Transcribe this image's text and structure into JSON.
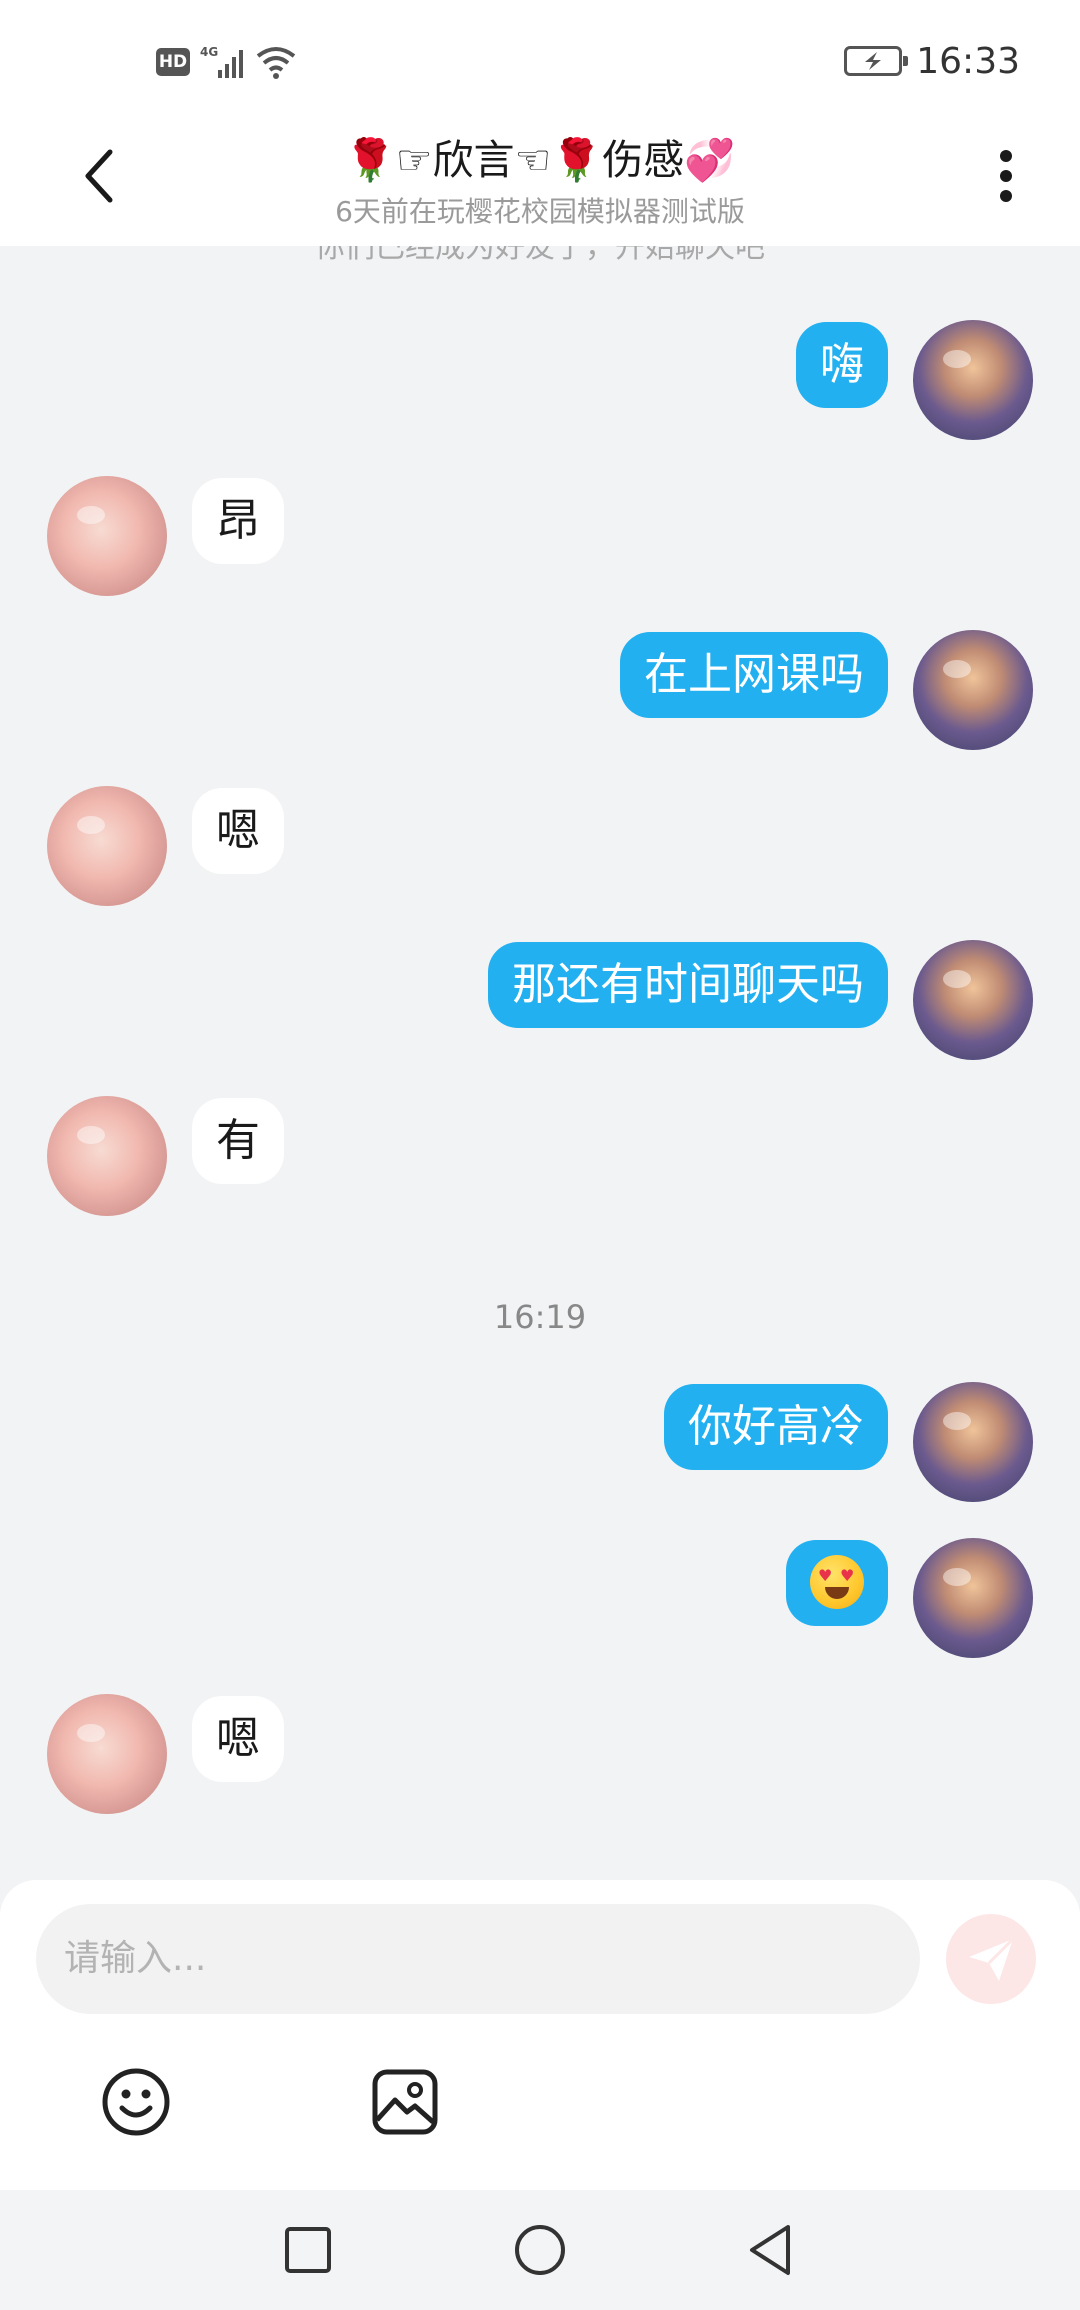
{
  "status_bar": {
    "hd": "HD",
    "network": "4G",
    "time": "16:33"
  },
  "header": {
    "title": "🌹☞欣言☜🌹伤感💞",
    "subtitle": "6天前在玩樱花校园模拟器测试版",
    "back_icon": "chevron-left-icon",
    "more_icon": "more-vertical-icon"
  },
  "chat": {
    "clipped_notice": "你们已经成为好友了，开始聊天吧",
    "time_divider": "16:19",
    "messages": [
      {
        "from": "me",
        "text": "嗨"
      },
      {
        "from": "them",
        "text": "昂"
      },
      {
        "from": "me",
        "text": "在上网课吗"
      },
      {
        "from": "them",
        "text": "嗯"
      },
      {
        "from": "me",
        "text": "那还有时间聊天吗"
      },
      {
        "from": "them",
        "text": "有"
      },
      {
        "from": "me",
        "text": "你好高冷"
      },
      {
        "from": "me",
        "emoji": "heart-eyes-emoji"
      },
      {
        "from": "them",
        "text": "嗯"
      }
    ]
  },
  "input": {
    "placeholder": "请输入...",
    "send_icon": "send-icon",
    "emoji_icon": "smiley-icon",
    "image_icon": "image-icon"
  },
  "nav": {
    "recents_icon": "square-icon",
    "home_icon": "circle-icon",
    "back_icon": "triangle-back-icon"
  },
  "colors": {
    "my_bubble": "#22b0f0",
    "their_bubble": "#ffffff",
    "background": "#f2f3f5",
    "send_button": "#fde6e6"
  }
}
